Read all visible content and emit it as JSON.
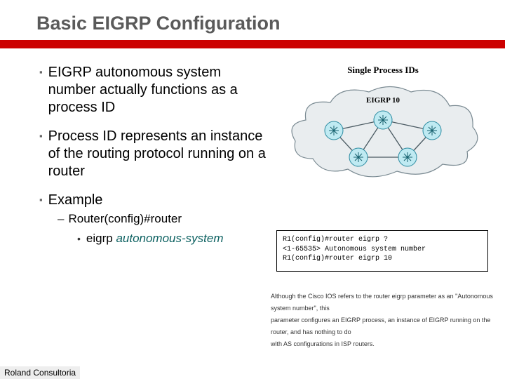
{
  "title": "Basic EIGRP Configuration",
  "bullets": {
    "b1": "EIGRP autonomous system number actually functions as a process ID",
    "b2": "Process ID represents an instance of the routing protocol running on a router",
    "b3": "Example",
    "sub1": "Router(config)#router",
    "sub2a": "eigrp ",
    "sub2b": "autonomous-system"
  },
  "diagram": {
    "title": "Single Process IDs",
    "label": "EIGRP 10"
  },
  "code": {
    "l1": "R1(config)#router eigrp ?",
    "l2": "  <1-65535>  Autonomous system number",
    "l3": "R1(config)#router eigrp 10"
  },
  "caption": {
    "l1": "Although the Cisco IOS refers to the router eigrp parameter as an \"Autonomous system number\", this",
    "l2": "parameter configures an EIGRP process, an instance of EIGRP running on the router, and has nothing to do",
    "l3": "with AS configurations in ISP routers."
  },
  "footer": "Roland Consultoria"
}
